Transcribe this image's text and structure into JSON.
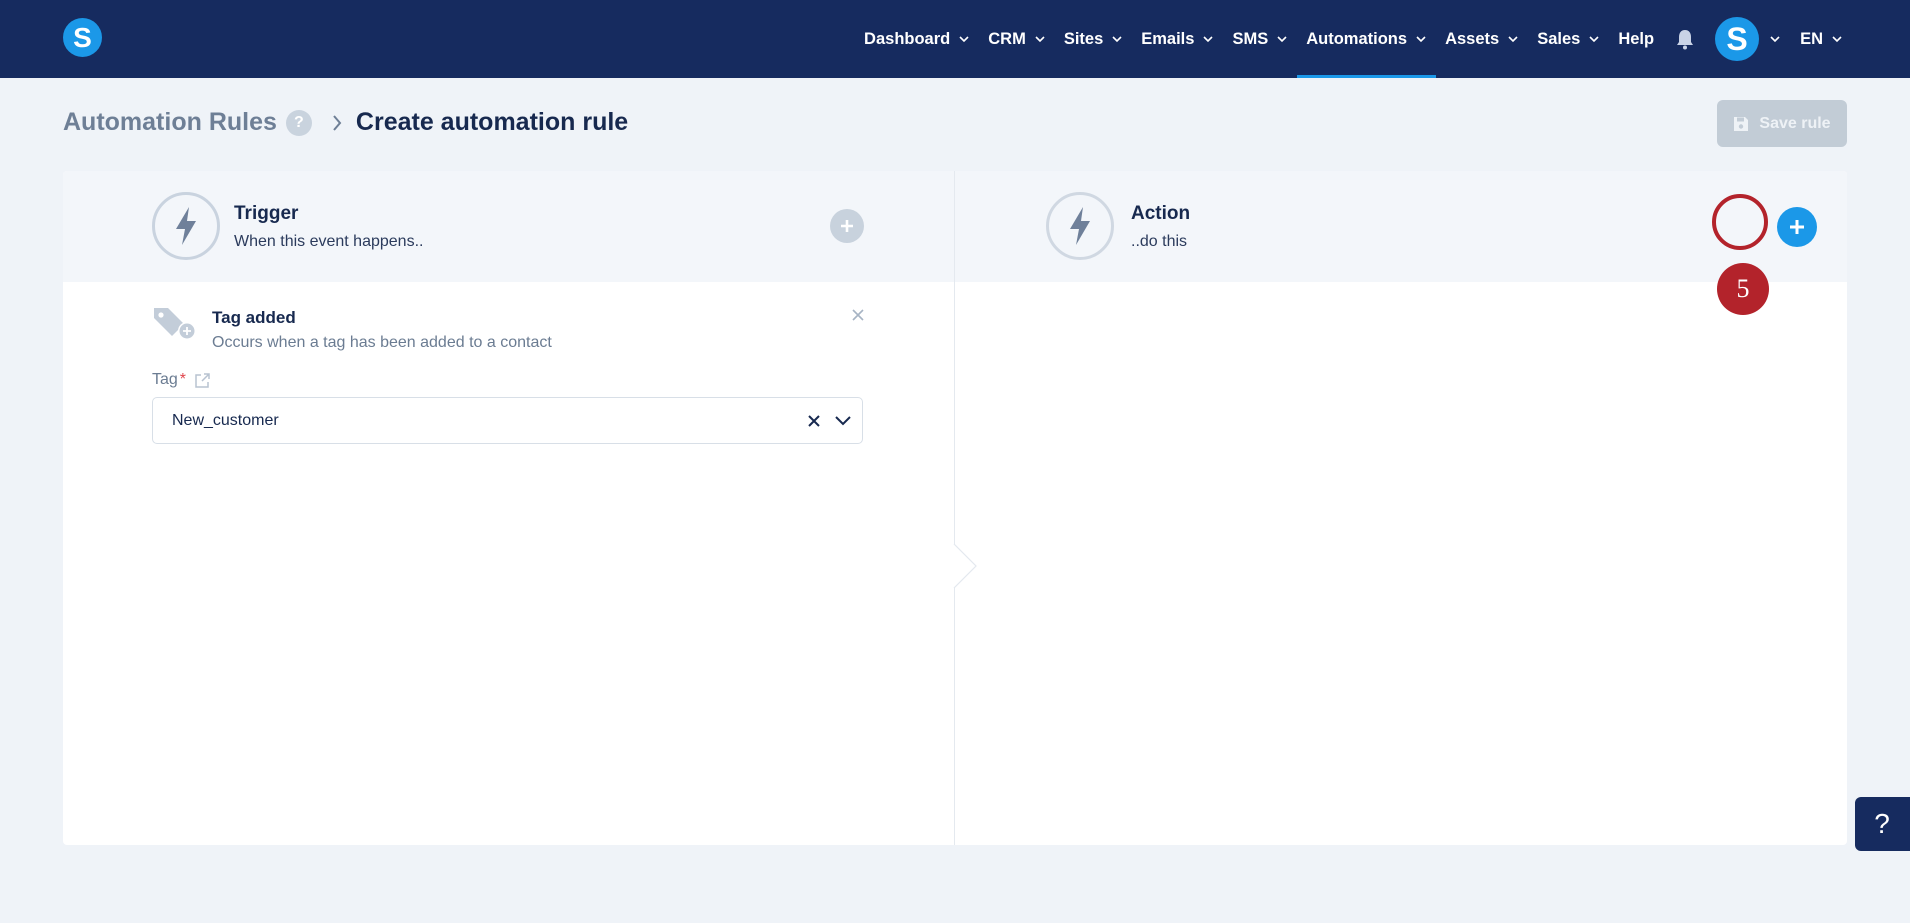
{
  "brand": {
    "logo_letter": "S"
  },
  "nav": {
    "items": [
      {
        "label": "Dashboard",
        "has_menu": true,
        "active": false
      },
      {
        "label": "CRM",
        "has_menu": true,
        "active": false
      },
      {
        "label": "Sites",
        "has_menu": true,
        "active": false
      },
      {
        "label": "Emails",
        "has_menu": true,
        "active": false
      },
      {
        "label": "SMS",
        "has_menu": true,
        "active": false
      },
      {
        "label": "Automations",
        "has_menu": true,
        "active": true
      },
      {
        "label": "Assets",
        "has_menu": true,
        "active": false
      },
      {
        "label": "Sales",
        "has_menu": true,
        "active": false
      },
      {
        "label": "Help",
        "has_menu": false,
        "active": false
      }
    ],
    "notifications_icon": "bell-icon",
    "avatar_letter": "S",
    "language": "EN"
  },
  "breadcrumb": {
    "root": "Automation Rules",
    "help_glyph": "?",
    "current": "Create automation rule"
  },
  "toolbar": {
    "save_label": "Save rule"
  },
  "trigger": {
    "title": "Trigger",
    "subtitle": "When this event happens..",
    "item": {
      "title": "Tag added",
      "description": "Occurs when a tag has been added to a contact",
      "field_label": "Tag",
      "required_mark": "*",
      "value": "New_customer"
    }
  },
  "action": {
    "title": "Action",
    "subtitle": "..do this"
  },
  "annotation": {
    "step_number": "5"
  },
  "help_widget": {
    "glyph": "?"
  },
  "colors": {
    "navbar": "#162b5f",
    "accent": "#1b98e8",
    "annotation_red": "#b3232b",
    "page_bg": "#eff3f8"
  }
}
